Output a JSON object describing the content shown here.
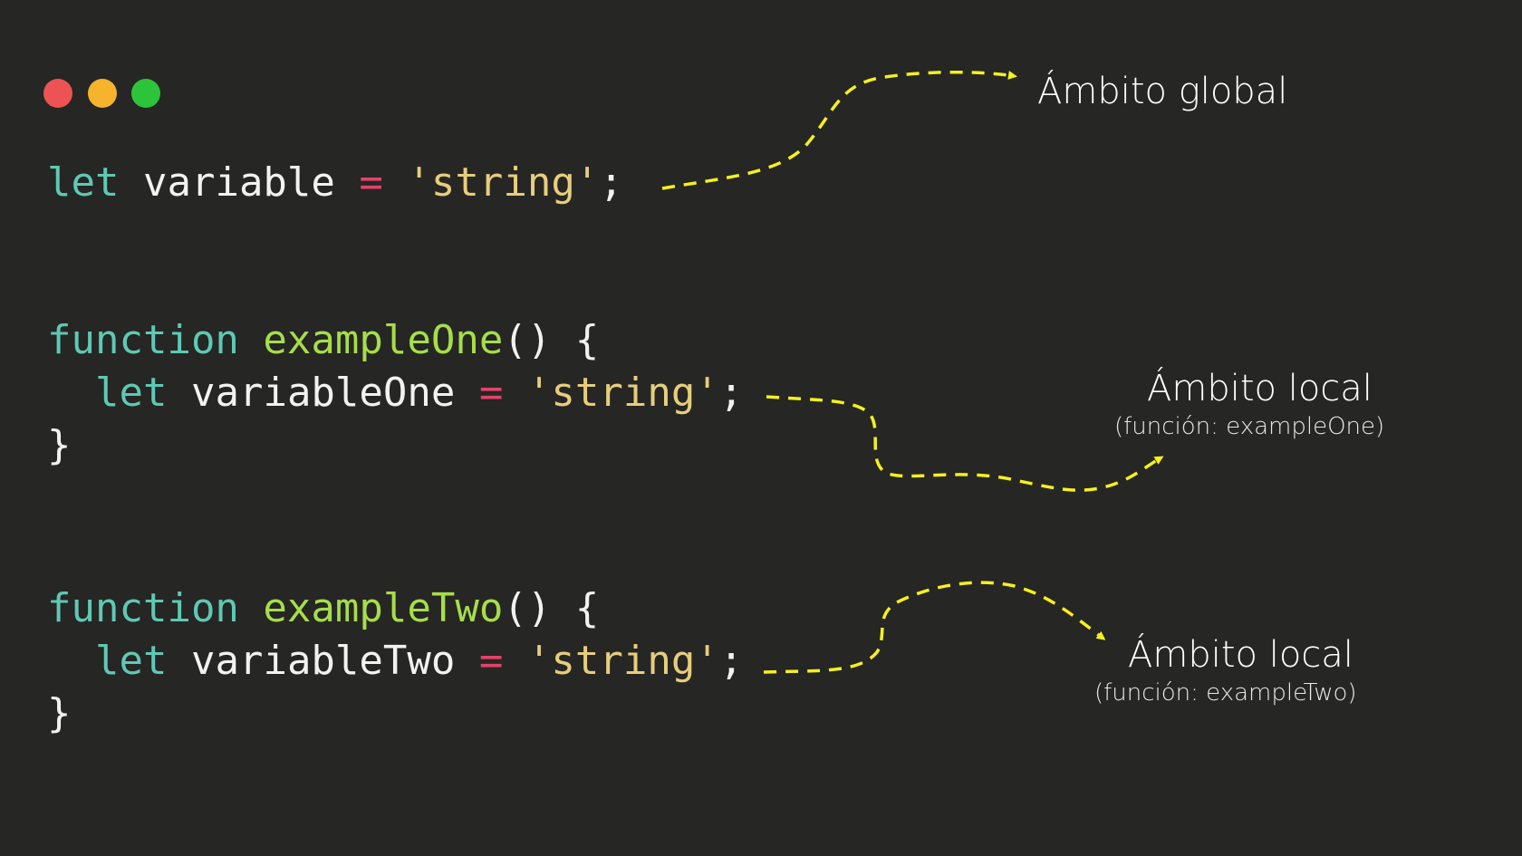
{
  "window": {
    "dots": [
      {
        "name": "close",
        "color": "#ed5354"
      },
      {
        "name": "minimize",
        "color": "#f6b42d"
      },
      {
        "name": "maximize",
        "color": "#2cc53a"
      }
    ]
  },
  "colors": {
    "background": "#262624",
    "keyword": "#5ec9b4",
    "identifier": "#f2f2f0",
    "operator": "#e3436b",
    "string": "#e7cd7c",
    "function_name": "#a6de4a",
    "arrow": "#f5f01e"
  },
  "code": {
    "line1": {
      "kw": "let",
      "id": "variable",
      "op": "=",
      "str": "'string'",
      "end": ";"
    },
    "line2": {
      "kw": "function",
      "fn": "exampleOne",
      "rest": "() {"
    },
    "line3": {
      "kw": "let",
      "id": "variableOne",
      "op": "=",
      "str": "'string'",
      "end": ";"
    },
    "line4": {
      "text": "}"
    },
    "line5": {
      "kw": "function",
      "fn": "exampleTwo",
      "rest": "() {"
    },
    "line6": {
      "kw": "let",
      "id": "variableTwo",
      "op": "=",
      "str": "'string'",
      "end": ";"
    },
    "line7": {
      "text": "}"
    }
  },
  "annotations": {
    "global": {
      "title": "Ámbito global"
    },
    "local_one": {
      "title": "Ámbito local",
      "subtitle": "(función: exampleOne)"
    },
    "local_two": {
      "title": "Ámbito local",
      "subtitle": "(función: exampleTwo)"
    }
  }
}
